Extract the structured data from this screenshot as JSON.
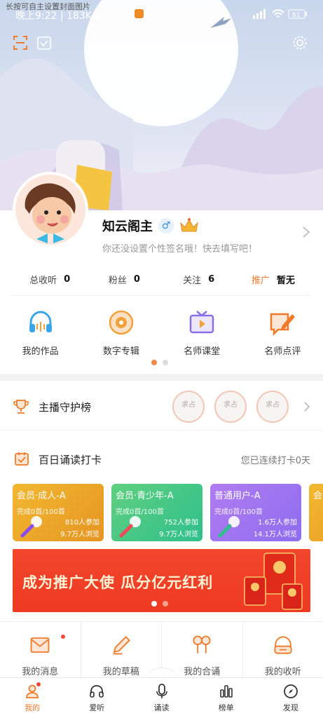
{
  "hint": "长按可自主设置封面图片",
  "status": {
    "time": "晚上9:22 | 183K/s",
    "battery": "61"
  },
  "profile": {
    "nickname": "知云阁主",
    "gender_symbol": "♂",
    "signature": "你还没设置个性签名哦！快去填写吧！"
  },
  "stats": [
    {
      "label": "总收听",
      "value": "0"
    },
    {
      "label": "粉丝",
      "value": "0"
    },
    {
      "label": "关注",
      "value": "6"
    },
    {
      "label": "推广",
      "value": "暂无"
    }
  ],
  "entries": [
    {
      "label": "我的作品",
      "icon": "headphones-icon"
    },
    {
      "label": "数字专辑",
      "icon": "album-icon"
    },
    {
      "label": "名师课堂",
      "icon": "tv-icon"
    },
    {
      "label": "名师点评",
      "icon": "comment-edit-icon"
    }
  ],
  "guardian": {
    "title": "主播守护榜",
    "badges": [
      "求占",
      "求占",
      "求占"
    ]
  },
  "checkin": {
    "title": "百日诵读打卡",
    "streak": "您已连续打卡0天",
    "cards": [
      {
        "title": "会员·成人-A",
        "progress": "完成0首/100首",
        "participants": "810人参加",
        "views": "9.7万人浏览",
        "color_from": "#f2b830",
        "color_to": "#e59522"
      },
      {
        "title": "会员·青少年-A",
        "progress": "完成0首/100首",
        "participants": "752人参加",
        "views": "9.7万人浏览",
        "color_from": "#5fd07f",
        "color_to": "#2fbf8c"
      },
      {
        "title": "普通用户-A",
        "progress": "完成0首/100首",
        "participants": "1.6万人参加",
        "views": "14.1万人浏览",
        "color_from": "#b07cf0",
        "color_to": "#8e6df0"
      },
      {
        "title": "会员",
        "progress": "",
        "participants": "",
        "views": "",
        "color_from": "#f2b830",
        "color_to": "#e59522"
      }
    ]
  },
  "banner": {
    "text": "成为推广大使  瓜分亿元红利"
  },
  "grid": [
    {
      "label": "我的消息",
      "icon": "mail-icon",
      "dot": true
    },
    {
      "label": "我的草稿",
      "icon": "pencil-icon",
      "dot": false
    },
    {
      "label": "我的合诵",
      "icon": "duet-icon",
      "dot": false
    },
    {
      "label": "我的收听",
      "icon": "listen-icon",
      "dot": false
    }
  ],
  "tabs": [
    {
      "label": "我的",
      "icon": "person-icon",
      "active": true
    },
    {
      "label": "爱听",
      "icon": "headset-icon",
      "active": false
    },
    {
      "label": "诵读",
      "icon": "mic-icon",
      "active": false
    },
    {
      "label": "榜单",
      "icon": "rank-icon",
      "active": false
    },
    {
      "label": "发现",
      "icon": "compass-icon",
      "active": false
    }
  ],
  "colors": {
    "accent": "#f07a2a",
    "banner": "#ee3a22"
  }
}
